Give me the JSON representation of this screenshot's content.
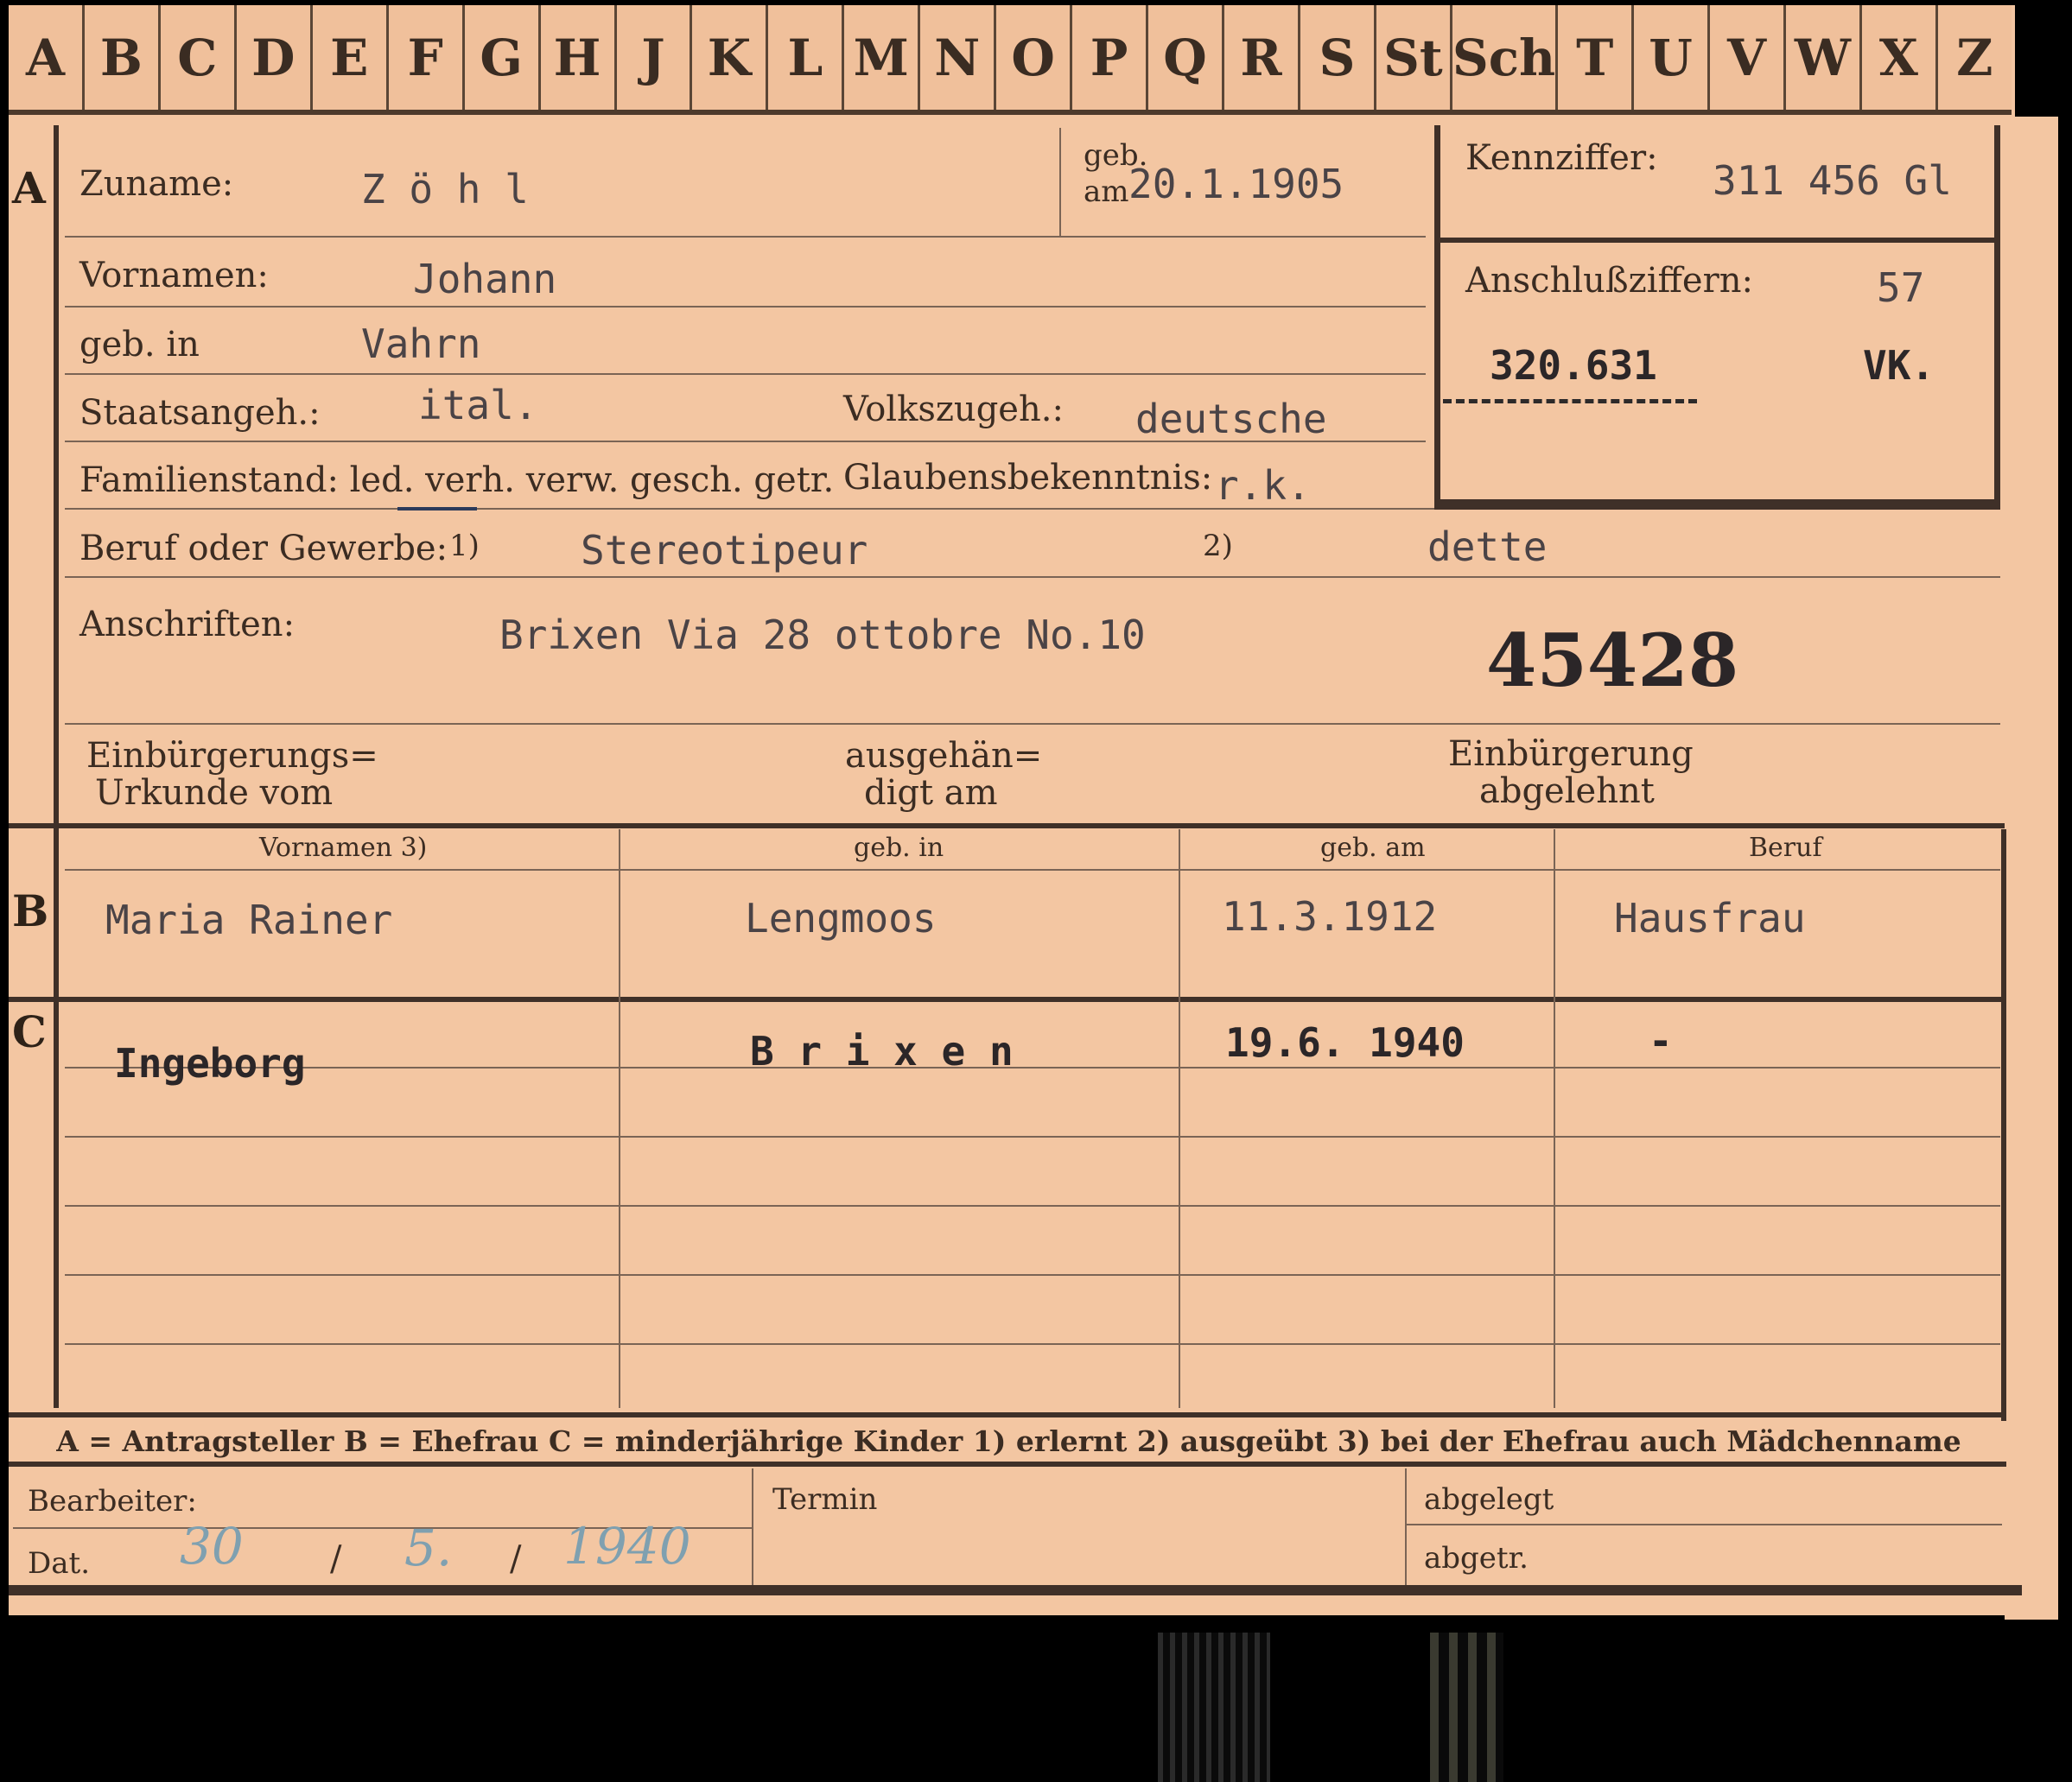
{
  "alphabet_tabs": [
    "A",
    "B",
    "C",
    "D",
    "E",
    "F",
    "G",
    "H",
    "J",
    "K",
    "L",
    "M",
    "N",
    "O",
    "P",
    "Q",
    "R",
    "S",
    "St",
    "Sch",
    "T",
    "U",
    "V",
    "W",
    "X",
    "Z"
  ],
  "sections": {
    "a": "A",
    "b": "B",
    "c": "C"
  },
  "applicant": {
    "surname_label": "Zuname:",
    "surname": "Z ö h l",
    "birthdate_label_1": "geb.",
    "birthdate_label_2": "am",
    "birthdate": "20.1.1905",
    "firstname_label": "Vornamen:",
    "firstname": "Johann",
    "birthplace_label": "geb. in",
    "birthplace": "Vahrn",
    "citizenship_label": "Staatsangeh.:",
    "citizenship": "ital.",
    "ethnicity_label": "Volkszugeh.:",
    "ethnicity": "deutsche",
    "family_status_label": "Familienstand: led. verh. verw. gesch. getr.",
    "religion_label": "Glaubensbekenntnis:",
    "religion": "r.k.",
    "occupation_label": "Beruf oder Gewerbe:",
    "occupation_note_1": "1)",
    "occupation_learned": "Stereotipeur",
    "occupation_note_2": "2)",
    "occupation_practiced": "dette",
    "address_label": "Anschriften:",
    "address": "Brixen Via 28 ottobre No.10",
    "file_number": "45428",
    "naturalization_cert_label_1": "Einbürgerungs=",
    "naturalization_cert_label_2": "Urkunde vom",
    "handed_over_label_1": "ausgehän=",
    "handed_over_label_2": "digt am",
    "naturalization_refused_label_1": "Einbürgerung",
    "naturalization_refused_label_2": "abgelehnt"
  },
  "id_box": {
    "kennziffer_label": "Kennziffer:",
    "kennziffer": "311 456 Gl",
    "anschluss_label": "Anschlußziffern:",
    "anschluss_value_1": "57",
    "anschluss_value_2": "320.631",
    "anschluss_value_3": "VK."
  },
  "table_headers": [
    "Vornamen 3)",
    "geb. in",
    "geb. am",
    "Beruf"
  ],
  "spouse": {
    "firstname": "Maria Rainer",
    "birthplace": "Lengmoos",
    "birthdate": "11.3.1912",
    "occupation": "Hausfrau"
  },
  "children": [
    {
      "firstname": "Ingeborg",
      "birthplace": "B r i x e n",
      "birthdate": "19.6. 1940",
      "occupation": "-"
    }
  ],
  "legend": "A = Antragsteller   B = Ehefrau   C = minderjährige Kinder   1) erlernt   2) ausgeübt   3) bei der Ehefrau auch Mädchenname",
  "footer": {
    "processor_label": "Bearbeiter:",
    "date_label": "Dat.",
    "date_day": "30",
    "date_month": "5.",
    "date_year": "1940",
    "date_sep": "/",
    "deadline_label": "Termin",
    "filed_label": "abgelegt",
    "returned_label": "abgetr."
  }
}
